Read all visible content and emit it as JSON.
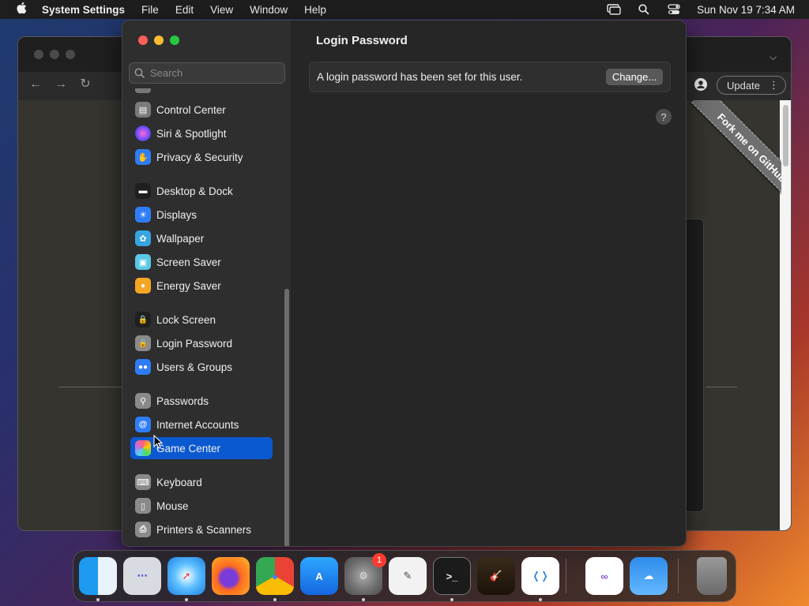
{
  "menubar": {
    "apple_icon": "apple-logo-icon",
    "app_name": "System Settings",
    "menus": [
      "File",
      "Edit",
      "View",
      "Window",
      "Help"
    ],
    "status_icons": [
      "screen-mirroring-icon",
      "spotlight-search-icon",
      "control-center-icon"
    ],
    "datetime": "Sun Nov 19  7:34 AM"
  },
  "browser": {
    "update_label": "Update",
    "ribbon_text": "Fork me on GitHub"
  },
  "settings": {
    "search_placeholder": "Search",
    "sidebar_items": [
      {
        "label": "Control Center",
        "icon": "control-center-icon",
        "color": "#7a7a7a"
      },
      {
        "label": "Siri & Spotlight",
        "icon": "siri-icon",
        "color": "#c23cb5"
      },
      {
        "label": "Privacy & Security",
        "icon": "hand-icon",
        "color": "#2f7df6"
      },
      {
        "label": "Desktop & Dock",
        "icon": "dock-icon",
        "color": "#1f1f1f"
      },
      {
        "label": "Displays",
        "icon": "sun-icon",
        "color": "#2f7df6"
      },
      {
        "label": "Wallpaper",
        "icon": "flower-icon",
        "color": "#37a4e0"
      },
      {
        "label": "Screen Saver",
        "icon": "screen-saver-icon",
        "color": "#5ac8e6"
      },
      {
        "label": "Energy Saver",
        "icon": "lightbulb-icon",
        "color": "#f5a623"
      },
      {
        "label": "Lock Screen",
        "icon": "lock-icon",
        "color": "#1f1f1f"
      },
      {
        "label": "Login Password",
        "icon": "lock-icon",
        "color": "#8a8a8a"
      },
      {
        "label": "Users & Groups",
        "icon": "users-icon",
        "color": "#2f7df6"
      },
      {
        "label": "Passwords",
        "icon": "key-icon",
        "color": "#8a8a8a"
      },
      {
        "label": "Internet Accounts",
        "icon": "at-icon",
        "color": "#2f7df6"
      },
      {
        "label": "Game Center",
        "icon": "game-center-icon",
        "color": "#ffffff"
      },
      {
        "label": "Keyboard",
        "icon": "keyboard-icon",
        "color": "#8a8a8a"
      },
      {
        "label": "Mouse",
        "icon": "mouse-icon",
        "color": "#8a8a8a"
      },
      {
        "label": "Printers & Scanners",
        "icon": "printer-icon",
        "color": "#8a8a8a"
      }
    ],
    "selected_item": "Game Center",
    "content": {
      "title": "Login Password",
      "row_text": "A login password has been set for this user.",
      "change_button": "Change...",
      "help_label": "?"
    }
  },
  "dock": {
    "apps": [
      {
        "name": "Finder",
        "icon": "finder-icon",
        "running": true
      },
      {
        "name": "Launchpad",
        "icon": "launchpad-icon",
        "running": false
      },
      {
        "name": "Safari",
        "icon": "safari-icon",
        "running": true
      },
      {
        "name": "Firefox",
        "icon": "firefox-icon",
        "running": false
      },
      {
        "name": "Google Chrome",
        "icon": "chrome-icon",
        "running": true
      },
      {
        "name": "App Store",
        "icon": "app-store-icon",
        "running": false
      },
      {
        "name": "System Settings",
        "icon": "system-settings-icon",
        "running": true,
        "badge": "1"
      },
      {
        "name": "TextEdit",
        "icon": "textedit-icon",
        "running": false
      },
      {
        "name": "Terminal",
        "icon": "terminal-icon",
        "running": true
      },
      {
        "name": "GarageBand",
        "icon": "garageband-icon",
        "running": false
      },
      {
        "name": "Visual Studio Code",
        "icon": "vscode-icon",
        "running": true
      },
      {
        "name": "Visual Studio",
        "icon": "visual-studio-icon",
        "running": false
      },
      {
        "name": "Weather",
        "icon": "weather-icon",
        "running": false
      },
      {
        "name": "Trash",
        "icon": "trash-icon",
        "running": false
      }
    ]
  }
}
